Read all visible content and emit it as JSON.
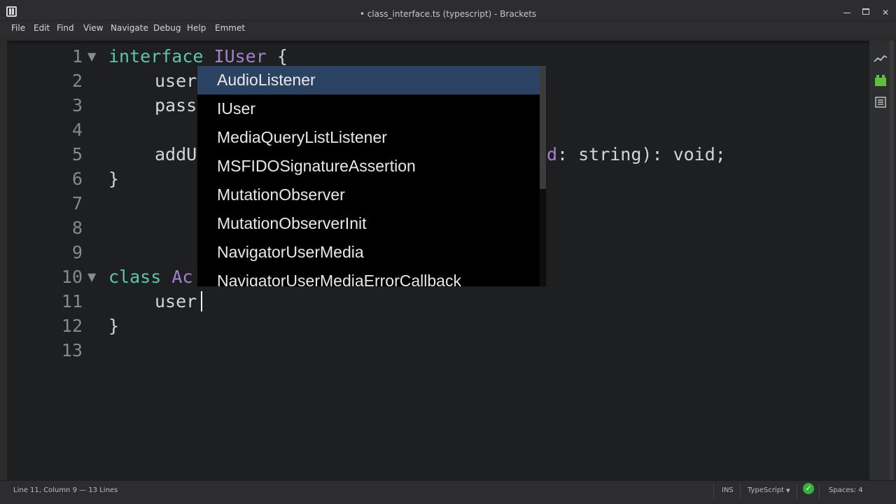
{
  "window": {
    "title": "• class_interface.ts (typescript) - Brackets",
    "minimize_glyph": "",
    "maximize_glyph": "",
    "close_glyph": "✕"
  },
  "menu": [
    "File",
    "Edit",
    "Find",
    "View",
    "Navigate",
    "Debug",
    "Help",
    "Emmet"
  ],
  "editor": {
    "line_numbers": [
      "1",
      "2",
      "3",
      "4",
      "5",
      "6",
      "7",
      "8",
      "9",
      "10",
      "11",
      "12",
      "13"
    ],
    "fold_glyph": "▼",
    "lines": {
      "l1_kw": "interface",
      "l1_type": "IUser",
      "l1_brace": "{",
      "l2": "user",
      "l3": "pass",
      "l5_start": "addU",
      "l5_param": "d",
      "l5_rest": ": string): void;",
      "l6": "}",
      "l10_kw": "class",
      "l10_type": "Ac",
      "l11": "user",
      "l12": "}"
    }
  },
  "code_hints": {
    "items": [
      "AudioListener",
      "IUser",
      "MediaQueryListListener",
      "MSFIDOSignatureAssertion",
      "MutationObserver",
      "MutationObserverInit",
      "NavigatorUserMedia",
      "NavigatorUserMediaErrorCallback"
    ],
    "selected_index": 0
  },
  "side_toolbar": {
    "icons": [
      "live-preview-icon",
      "extension-manager-icon",
      "file-outline-icon"
    ]
  },
  "status": {
    "cursor_position": "Line 11, Column 9",
    "separator": "—",
    "line_count": "13 Lines",
    "insert_mode": "INS",
    "language": "TypeScript",
    "language_caret": "▼",
    "lint_glyph": "✓",
    "indent": "Spaces: 4"
  },
  "colors": {
    "editor_bg": "#1d1f21",
    "keyword": "#5bc8a8",
    "type_name": "#a680d0",
    "hint_selected": "#2c4262",
    "lint_ok": "#34b33a"
  }
}
